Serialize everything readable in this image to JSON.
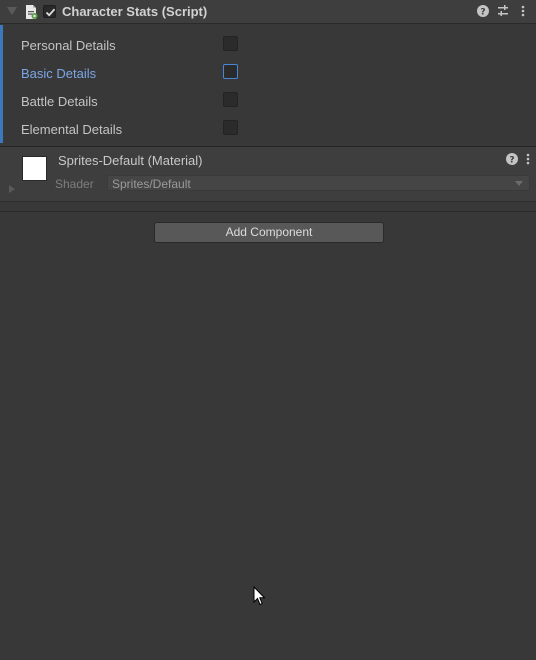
{
  "component": {
    "title": "Character Stats (Script)",
    "enabled": true,
    "icons": [
      "help-icon",
      "preset-icon",
      "kebab-menu-icon"
    ]
  },
  "fields": [
    {
      "label": "Personal Details",
      "checked": false,
      "active": false
    },
    {
      "label": "Basic Details",
      "checked": false,
      "active": true
    },
    {
      "label": "Battle Details",
      "checked": false,
      "active": false
    },
    {
      "label": "Elemental Details",
      "checked": false,
      "active": false
    }
  ],
  "material": {
    "title": "Sprites-Default (Material)",
    "shader_label": "Shader",
    "shader_value": "Sprites/Default"
  },
  "add_component_label": "Add Component",
  "colors": {
    "background": "#383838",
    "accent": "#3a79bb",
    "active_label": "#7ba5e6"
  }
}
